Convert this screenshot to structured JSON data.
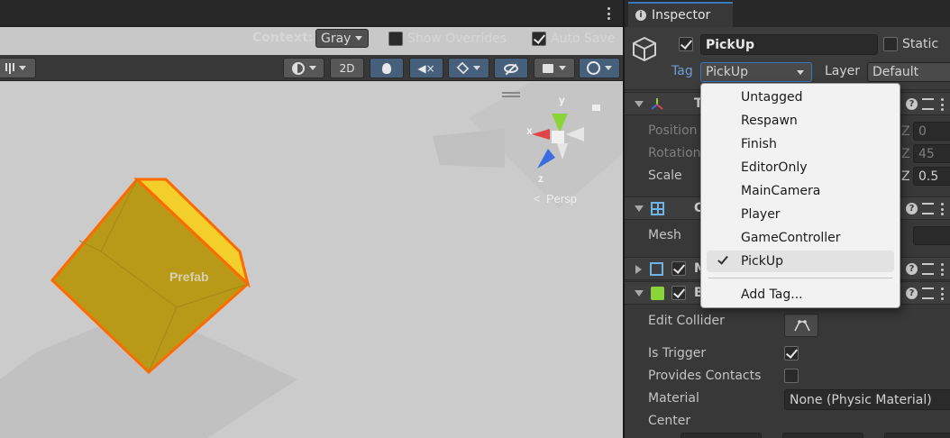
{
  "scene": {
    "context_label": "Context:",
    "context_value": "Gray",
    "show_overrides_label": "Show Overrides",
    "show_overrides_checked": false,
    "auto_save_label": "Auto Save",
    "auto_save_checked": true,
    "toolbar": {
      "mode_2d_label": "2D"
    },
    "object_label": "Prefab",
    "gizmo": {
      "y_label": "y",
      "x_label": "x",
      "z_label": "z",
      "projection_label": "Persp"
    },
    "colors": {
      "cube_face": "#b89a18",
      "cube_top": "#f2cf2a",
      "outline": "#ff6a00",
      "gizmo_x": "#e04444",
      "gizmo_y": "#8ad43a",
      "gizmo_z": "#3c6de0"
    }
  },
  "inspector": {
    "tab_label": "Inspector",
    "object_name": "PickUp",
    "active_checked": true,
    "static_label": "Static",
    "static_checked": false,
    "tag_label": "Tag",
    "tag_value": "PickUp",
    "layer_label": "Layer",
    "layer_value": "Default",
    "transform": {
      "title_initial": "T",
      "position_label": "Position",
      "rotation_label": "Rotation",
      "scale_label": "Scale",
      "position_z": "0",
      "rotation_z": "45",
      "scale_z": "0.5",
      "axis_z": "Z"
    },
    "mesh_filter": {
      "title_initial": "C",
      "mesh_label": "Mesh"
    },
    "mesh_renderer": {
      "title_initial": "M"
    },
    "box_collider": {
      "title_initial": "B",
      "edit_collider_label": "Edit Collider",
      "is_trigger_label": "Is Trigger",
      "is_trigger_checked": true,
      "provides_contacts_label": "Provides Contacts",
      "provides_contacts_checked": false,
      "material_label": "Material",
      "material_value": "None (Physic Material)",
      "center_label": "Center"
    }
  },
  "tag_dropdown": {
    "items": [
      "Untagged",
      "Respawn",
      "Finish",
      "EditorOnly",
      "MainCamera",
      "Player",
      "GameController",
      "PickUp"
    ],
    "selected": "PickUp",
    "add_tag_label": "Add Tag..."
  }
}
